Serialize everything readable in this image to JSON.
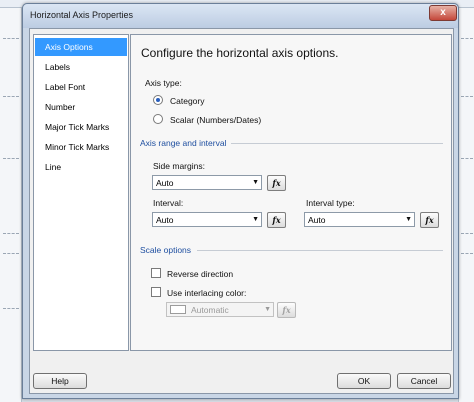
{
  "dialog": {
    "title": "Horizontal Axis Properties",
    "close_glyph": "x"
  },
  "nav": {
    "items": [
      "Axis Options",
      "Labels",
      "Label Font",
      "Number",
      "Major Tick Marks",
      "Minor Tick Marks",
      "Line"
    ],
    "selected": "Axis Options"
  },
  "content": {
    "heading": "Configure the horizontal axis options.",
    "axis_type": {
      "label": "Axis type:",
      "options": [
        "Category",
        "Scalar (Numbers/Dates)"
      ],
      "selected": "Category"
    },
    "range": {
      "section_title": "Axis range and interval",
      "side_margins_label": "Side margins:",
      "side_margins_value": "Auto",
      "interval_label": "Interval:",
      "interval_value": "Auto",
      "interval_type_label": "Interval type:",
      "interval_type_value": "Auto"
    },
    "scale": {
      "section_title": "Scale options",
      "reverse_label": "Reverse direction",
      "reverse_checked": false,
      "interlacing_label": "Use interlacing color:",
      "interlacing_checked": false,
      "color_value": "Automatic"
    },
    "fx_label": "fx"
  },
  "footer": {
    "help": "Help",
    "ok": "OK",
    "cancel": "Cancel"
  },
  "colors": {
    "selection": "#3399ff",
    "section_text": "#1f4fa0",
    "title_bar": "#c9d6e6"
  }
}
